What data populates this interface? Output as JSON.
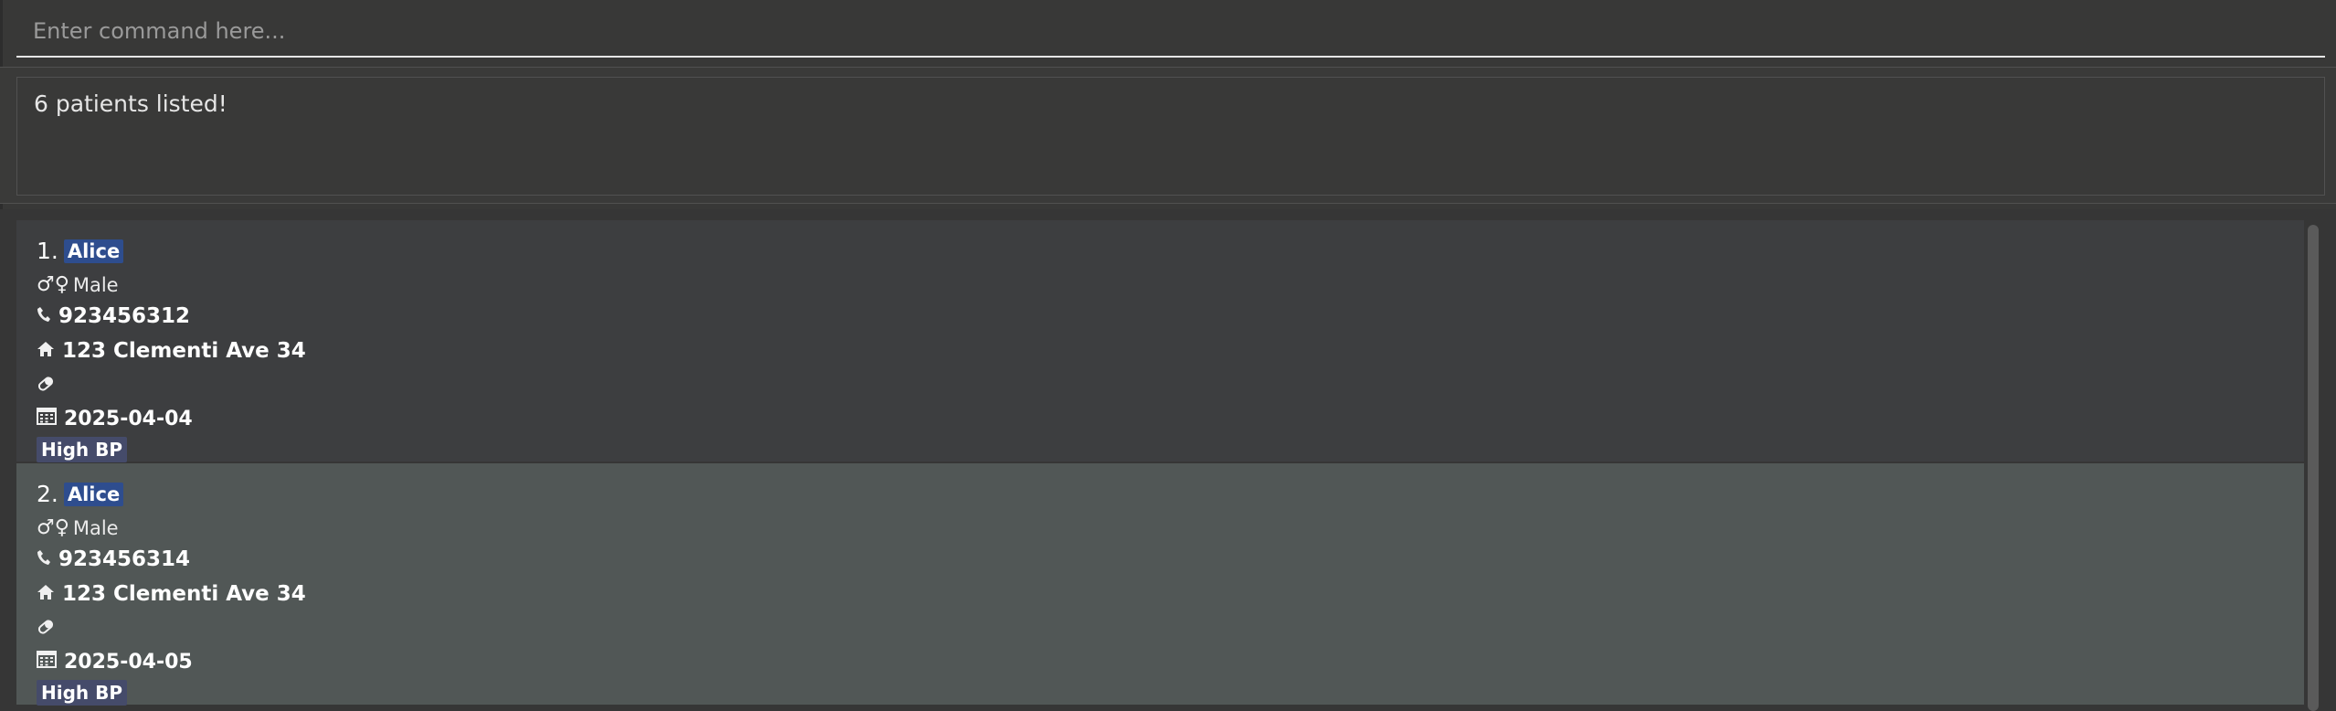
{
  "command": {
    "placeholder": "Enter command here...",
    "value": ""
  },
  "result": {
    "message": "6 patients listed!"
  },
  "patients": [
    {
      "index": "1.",
      "name": "Alice",
      "gender": "Male",
      "phone": "923456312",
      "address": "123 Clementi Ave 34",
      "medication": "",
      "date": "2025-04-04",
      "tags": [
        "High BP"
      ]
    },
    {
      "index": "2.",
      "name": "Alice",
      "gender": "Male",
      "phone": "923456314",
      "address": "123 Clementi Ave 34",
      "medication": "",
      "date": "2025-04-05",
      "tags": [
        "High BP"
      ]
    }
  ],
  "icons": {
    "gender": "gender-icon",
    "phone": "phone-icon",
    "address": "home-icon",
    "medication": "pill-icon",
    "date": "calendar-icon"
  },
  "colors": {
    "background": "#383837",
    "card_default": "#3d3e40",
    "card_selected": "#515756",
    "name_badge": "#2e4d8e",
    "tag_badge": "#454b6a"
  }
}
